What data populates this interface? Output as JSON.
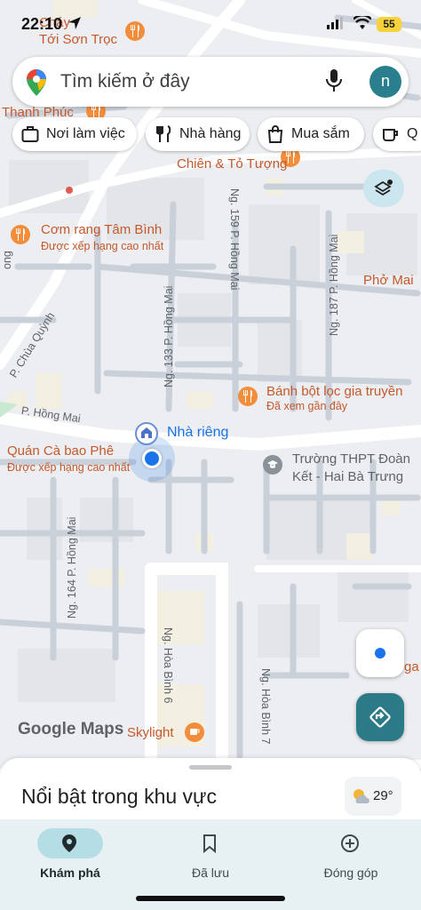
{
  "status_bar": {
    "time": "22:10",
    "battery": "55"
  },
  "search": {
    "placeholder": "Tìm kiếm ở đây",
    "avatar_letter": "n"
  },
  "chips": [
    {
      "label": "Nơi làm việc",
      "icon": "briefcase-icon"
    },
    {
      "label": "Nhà hàng",
      "icon": "fork-knife-icon"
    },
    {
      "label": "Mua sắm",
      "icon": "shopping-bag-icon"
    },
    {
      "label": "Q",
      "icon": "coffee-cup-icon"
    }
  ],
  "map": {
    "places": {
      "top_left": "Cháy\nTới Sơn Trọc",
      "thanh_phuc": "Thanh Phúc",
      "chien_to_tuong": "Chiên & Tỏ Tượng",
      "com_rang": "Cơm rang Tâm Bình",
      "com_rang_sub": "Được xếp hạng cao nhất",
      "pho_mai": "Phở Mai",
      "banh_bot_loc": "Bánh bột lọc gia truyền",
      "banh_bot_loc_sub": "Đã xem gần đây",
      "nha_rieng": "Nhà riêng",
      "quan_ca": "Quán Cà bao Phê",
      "quan_ca_sub": "Được xếp hạng cao nhất",
      "truong_thpt": "Trường THPT Đoàn\nKết - Hai Bà Trưng",
      "skylight": "Skylight",
      "edge_ga": "ga"
    },
    "streets": {
      "ng159": "Ng. 159 P. Hồng Mai",
      "ng187": "Ng. 187 P. Hồng Mai",
      "ng133": "Ng. 133 P. Hồng Mai",
      "chua_quynh": "P. Chùa Quỳnh",
      "hong_mai": "P. Hồng Mai",
      "ng164": "Ng. 164 P. Hồng Mai",
      "hoa_binh6": "Ng. Hòa Bình 6",
      "hoa_binh7": "Ng. Hòa Bình 7",
      "ong": "ong"
    },
    "logo": "Google Maps"
  },
  "sheet": {
    "title": "Nổi bật trong khu vực",
    "temperature": "29°"
  },
  "nav": [
    {
      "label": "Khám phá",
      "icon": "explore-pin-icon",
      "active": true
    },
    {
      "label": "Đã lưu",
      "icon": "bookmark-icon",
      "active": false
    },
    {
      "label": "Đóng góp",
      "icon": "add-circle-icon",
      "active": false
    }
  ],
  "colors": {
    "accent": "#1a73e8",
    "teal": "#2c7a87",
    "poi": "#c5592c",
    "map_bg": "#eceef1",
    "road": "#ffffff"
  }
}
